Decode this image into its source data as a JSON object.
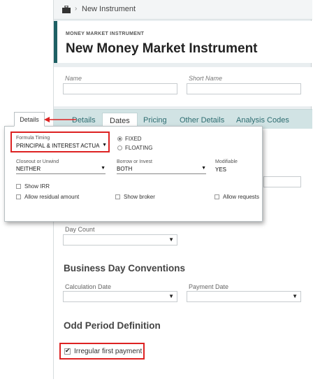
{
  "breadcrumb": {
    "home_icon": "briefcase-icon",
    "separator": "›",
    "current": "New Instrument"
  },
  "header": {
    "kicker": "MONEY MARKET INSTRUMENT",
    "title": "New Money Market Instrument"
  },
  "fields": {
    "name_label": "Name",
    "short_name_label": "Short Name"
  },
  "tabs": [
    "Details",
    "Dates",
    "Pricing",
    "Other Details",
    "Analysis Codes"
  ],
  "popup": {
    "tab_label": "Details",
    "formula_timing_label": "Formula Timing",
    "formula_timing_value": "PRINCIPAL & INTEREST ACTUA",
    "radio_fixed": "FIXED",
    "radio_floating": "FLOATING",
    "closeout_label": "Closeout or Unwind",
    "closeout_value": "NEITHER",
    "borrow_label": "Borrow or Invest",
    "borrow_value": "BOTH",
    "modifiable_label": "Modifiable",
    "modifiable_value": "YES",
    "show_irr": "Show IRR",
    "allow_residual": "Allow residual amount",
    "show_broker": "Show broker",
    "allow_requests": "Allow requests"
  },
  "day_count": {
    "label": "Day Count"
  },
  "business_day": {
    "title": "Business Day Conventions",
    "calc_label": "Calculation Date",
    "payment_label": "Payment Date"
  },
  "odd_period": {
    "title": "Odd Period Definition",
    "irregular_label": "Irregular first payment",
    "irregular_checked": true
  },
  "colors": {
    "accent": "#1e6064",
    "highlight": "#dd2222",
    "tab_bg": "#d1e3e4"
  }
}
